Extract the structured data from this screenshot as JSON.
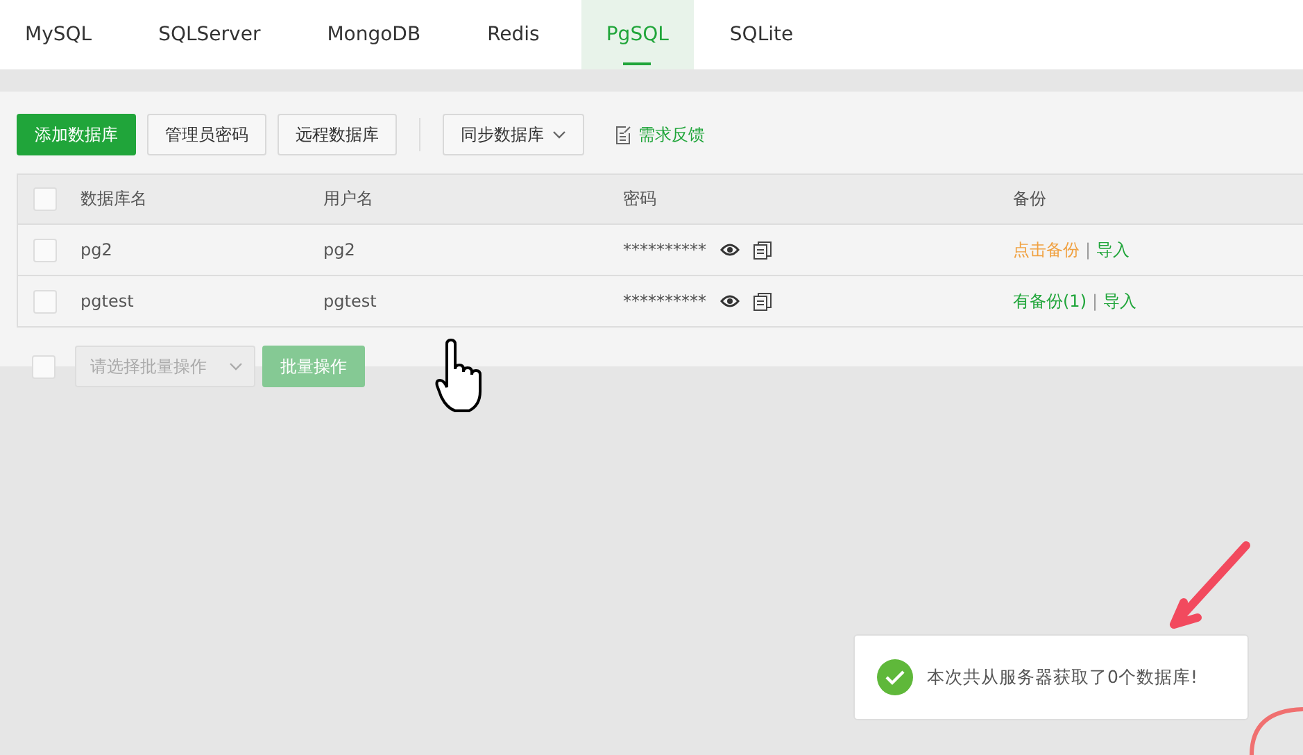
{
  "tabs": [
    {
      "label": "MySQL",
      "selected": false
    },
    {
      "label": "SQLServer",
      "selected": false
    },
    {
      "label": "MongoDB",
      "selected": false
    },
    {
      "label": "Redis",
      "selected": false
    },
    {
      "label": "PgSQL",
      "selected": true
    },
    {
      "label": "SQLite",
      "selected": false
    }
  ],
  "toolbar": {
    "add_button": "添加数据库",
    "admin_password_button": "管理员密码",
    "remote_button": "远程数据库",
    "sync_dropdown": "同步数据库",
    "feedback_link": "需求反馈"
  },
  "table": {
    "select_all_checked": false,
    "columns": [
      "数据库名",
      "用户名",
      "密码",
      "备份"
    ],
    "rows": [
      {
        "checked": false,
        "name": "pg2",
        "user": "pg2",
        "password": "**********",
        "backup": {
          "label": "点击备份",
          "kind": "none"
        },
        "separator": "|",
        "import": "导入"
      },
      {
        "checked": false,
        "name": "pgtest",
        "user": "pgtest",
        "password": "**********",
        "backup": {
          "label": "有备份(1)",
          "kind": "exists"
        },
        "separator": "|",
        "import": "导入"
      }
    ]
  },
  "batch": {
    "checked": false,
    "placeholder": "请选择批量操作",
    "button": "批量操作",
    "disabled": true
  },
  "toast": {
    "kind": "success",
    "message": "本次共从服务器获取了0个数据库!"
  }
}
